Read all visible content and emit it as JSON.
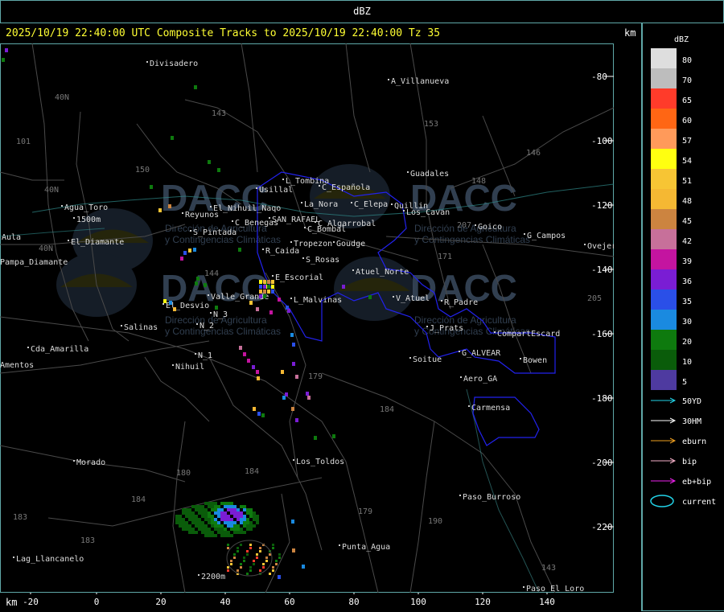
{
  "window": {
    "title": "dBZ"
  },
  "header": {
    "timestamp_text": "2025/10/19 22:40:00 UTC Composite Tracks to 2025/10/19 22:40:00 Tz 35",
    "unit_top": "km",
    "unit_bottom": "km"
  },
  "colors": {
    "border": "#5fa8a8",
    "timestamp": "#ffff33",
    "roads": "#555555",
    "boundary": "#2222ee",
    "towns": "#dddddd"
  },
  "legend": {
    "title": "dBZ",
    "bins": [
      {
        "label": "80",
        "color": "#dedede"
      },
      {
        "label": "70",
        "color": "#bdbdbd"
      },
      {
        "label": "65",
        "color": "#ff3b2a"
      },
      {
        "label": "60",
        "color": "#ff6614"
      },
      {
        "label": "57",
        "color": "#ff9a5a"
      },
      {
        "label": "54",
        "color": "#ffff10"
      },
      {
        "label": "51",
        "color": "#f7c534"
      },
      {
        "label": "48",
        "color": "#f5b833"
      },
      {
        "label": "45",
        "color": "#cc8440"
      },
      {
        "label": "42",
        "color": "#c7709a"
      },
      {
        "label": "39",
        "color": "#c414a0"
      },
      {
        "label": "36",
        "color": "#7a1dd4"
      },
      {
        "label": "35",
        "color": "#2a4fe8"
      },
      {
        "label": "30",
        "color": "#1a8ae0"
      },
      {
        "label": "20",
        "color": "#0e7a0e"
      },
      {
        "label": "10",
        "color": "#0a5c0a"
      },
      {
        "label": "5",
        "color": "#4e3aa0"
      }
    ],
    "tracks": [
      {
        "label": "50YD",
        "color": "#22d3e8",
        "icon": "arrow-icon"
      },
      {
        "label": "30HM",
        "color": "#ffffff",
        "icon": "arrow-icon"
      },
      {
        "label": "eburn",
        "color": "#f0a020",
        "icon": "arrow-icon"
      },
      {
        "label": "bip",
        "color": "#f4b0c8",
        "icon": "arrow-icon"
      },
      {
        "label": "eb+bip",
        "color": "#ee22ee",
        "icon": "arrow-icon"
      },
      {
        "label": "current",
        "color": "#22d3e8",
        "icon": "ellipse-icon"
      }
    ]
  },
  "axes": {
    "x_ticks": [
      "-20",
      "0",
      "20",
      "40",
      "60",
      "80",
      "100",
      "120",
      "140"
    ],
    "y_ticks": [
      "-80",
      "-100",
      "-120",
      "-140",
      "-160",
      "-180",
      "-200",
      "-220"
    ]
  },
  "towns": [
    "Divisadero",
    "A_Villanueva",
    "Guadales",
    "Usillal",
    "L_Tombina",
    "C_Española",
    "La_Nora",
    "C_Elepa",
    "Agua_Toro",
    "1500m",
    "Reyunos",
    "El_Nihuil_Naqo",
    "C_Benegas",
    "SAN_RAFAEL",
    "C_Algarrobal",
    "Quillin",
    "Los_Cavan",
    "Goico",
    "G_Campos",
    "Ovejero",
    "El_Diamante",
    "Aula",
    "S_Pintada",
    "C_Bombal",
    "Tropezon",
    "Goudge",
    "Pampa_Diamante",
    "R_Caida",
    "S_Rosas",
    "E_Escorial",
    "Atuel_Norte",
    "Valle_Grande",
    "El_Desvio",
    "L_Malvinas",
    "V_Atuel",
    "R_Padre",
    "Salinas",
    "N_2",
    "N_3",
    "J_Prats",
    "CompartEscard",
    "Cda_Amarilla",
    "N_1",
    "Nihuil",
    "G_ALVEAR",
    "Soitue",
    "Bowen",
    "Amentos",
    "Aero_GA",
    "Carmensa",
    "Morado",
    "Los_Toldos",
    "Paso_Burroso",
    "Punta_Agua",
    "Lag_Llancanelo",
    "2200m",
    "Paso_El_Loro"
  ],
  "route_numbers": [
    "40N",
    "101",
    "143",
    "153",
    "146",
    "148",
    "150",
    "207",
    "171",
    "40N",
    "40N",
    "144",
    "205",
    "179",
    "184",
    "180",
    "184",
    "179",
    "190",
    "183",
    "183",
    "184",
    "143"
  ],
  "watermark": {
    "brand": "DACC",
    "line1": "Dirección de Agricultura",
    "line2": "y Contingencias Climáticas"
  }
}
